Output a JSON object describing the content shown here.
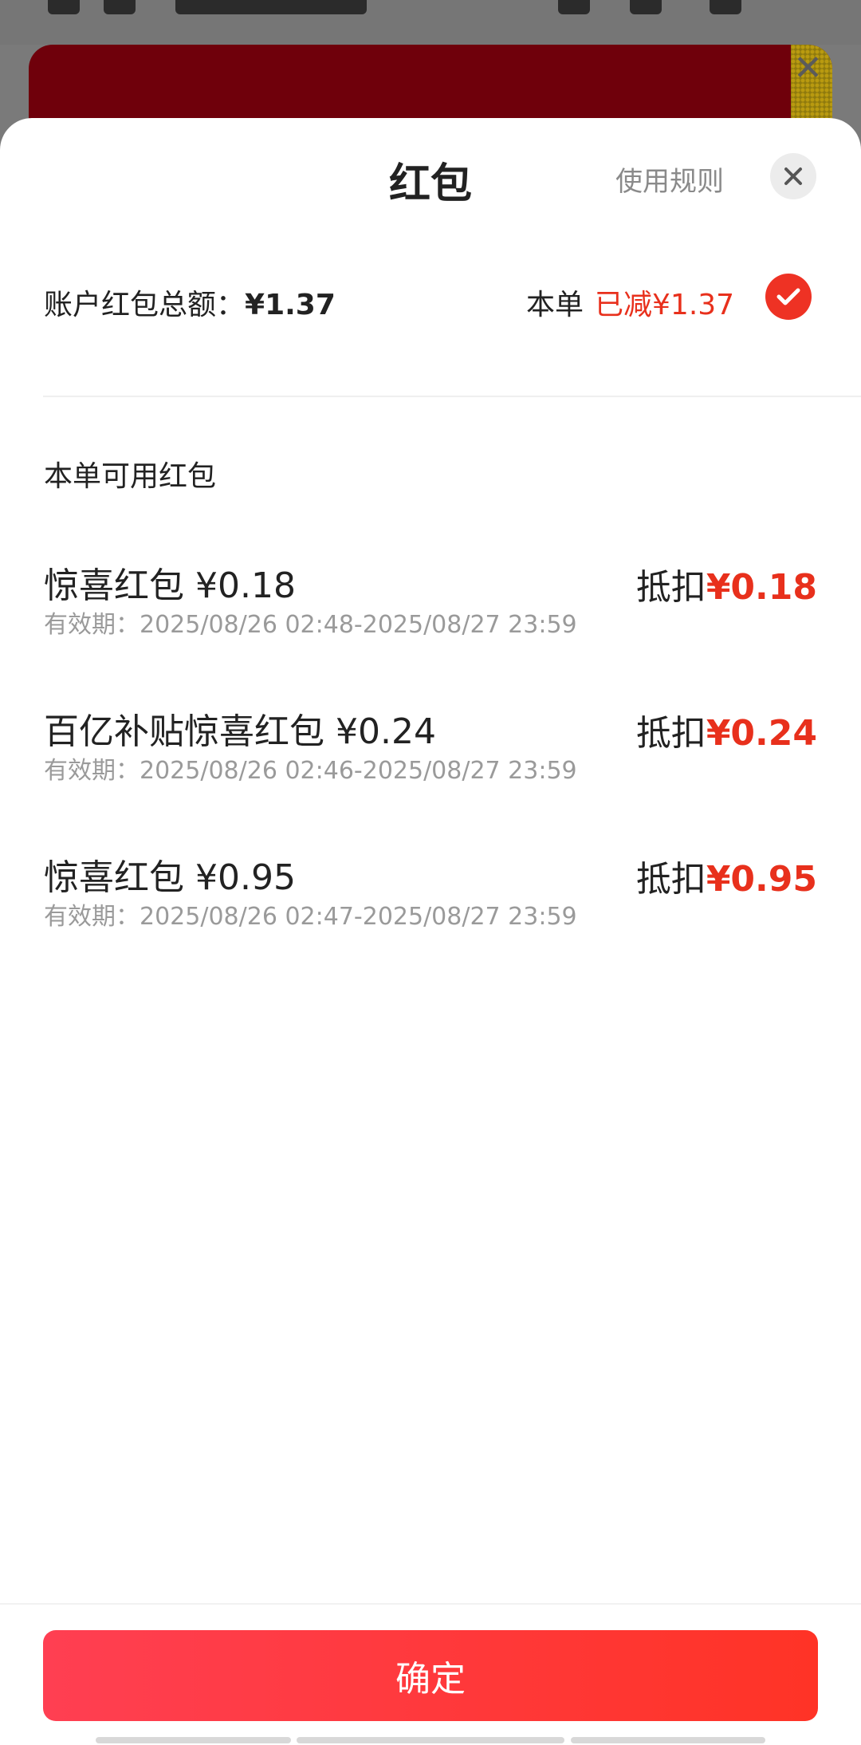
{
  "sheet": {
    "title": "红包",
    "rules_link": "使用规则",
    "account_total_label": "账户红包总额：",
    "account_total_value": "¥1.37",
    "order_label": "本单",
    "order_discount": "已减¥1.37",
    "section_title": "本单可用红包",
    "confirm_label": "确定",
    "icons": {
      "close": "close-icon",
      "check": "check-icon"
    },
    "colors": {
      "accent_red": "#e8301c",
      "button_gradient_start": "#ff3f52",
      "button_gradient_end": "#ff3326"
    }
  },
  "packets": [
    {
      "name": "惊喜红包 ¥0.18",
      "validity": "有效期：2025/08/26 02:48-2025/08/27 23:59",
      "deduct_label": "抵扣",
      "deduct_amount": "¥0.18"
    },
    {
      "name": "百亿补贴惊喜红包 ¥0.24",
      "validity": "有效期：2025/08/26 02:46-2025/08/27 23:59",
      "deduct_label": "抵扣",
      "deduct_amount": "¥0.24"
    },
    {
      "name": "惊喜红包 ¥0.95",
      "validity": "有效期：2025/08/26 02:47-2025/08/27 23:59",
      "deduct_label": "抵扣",
      "deduct_amount": "¥0.95"
    }
  ]
}
